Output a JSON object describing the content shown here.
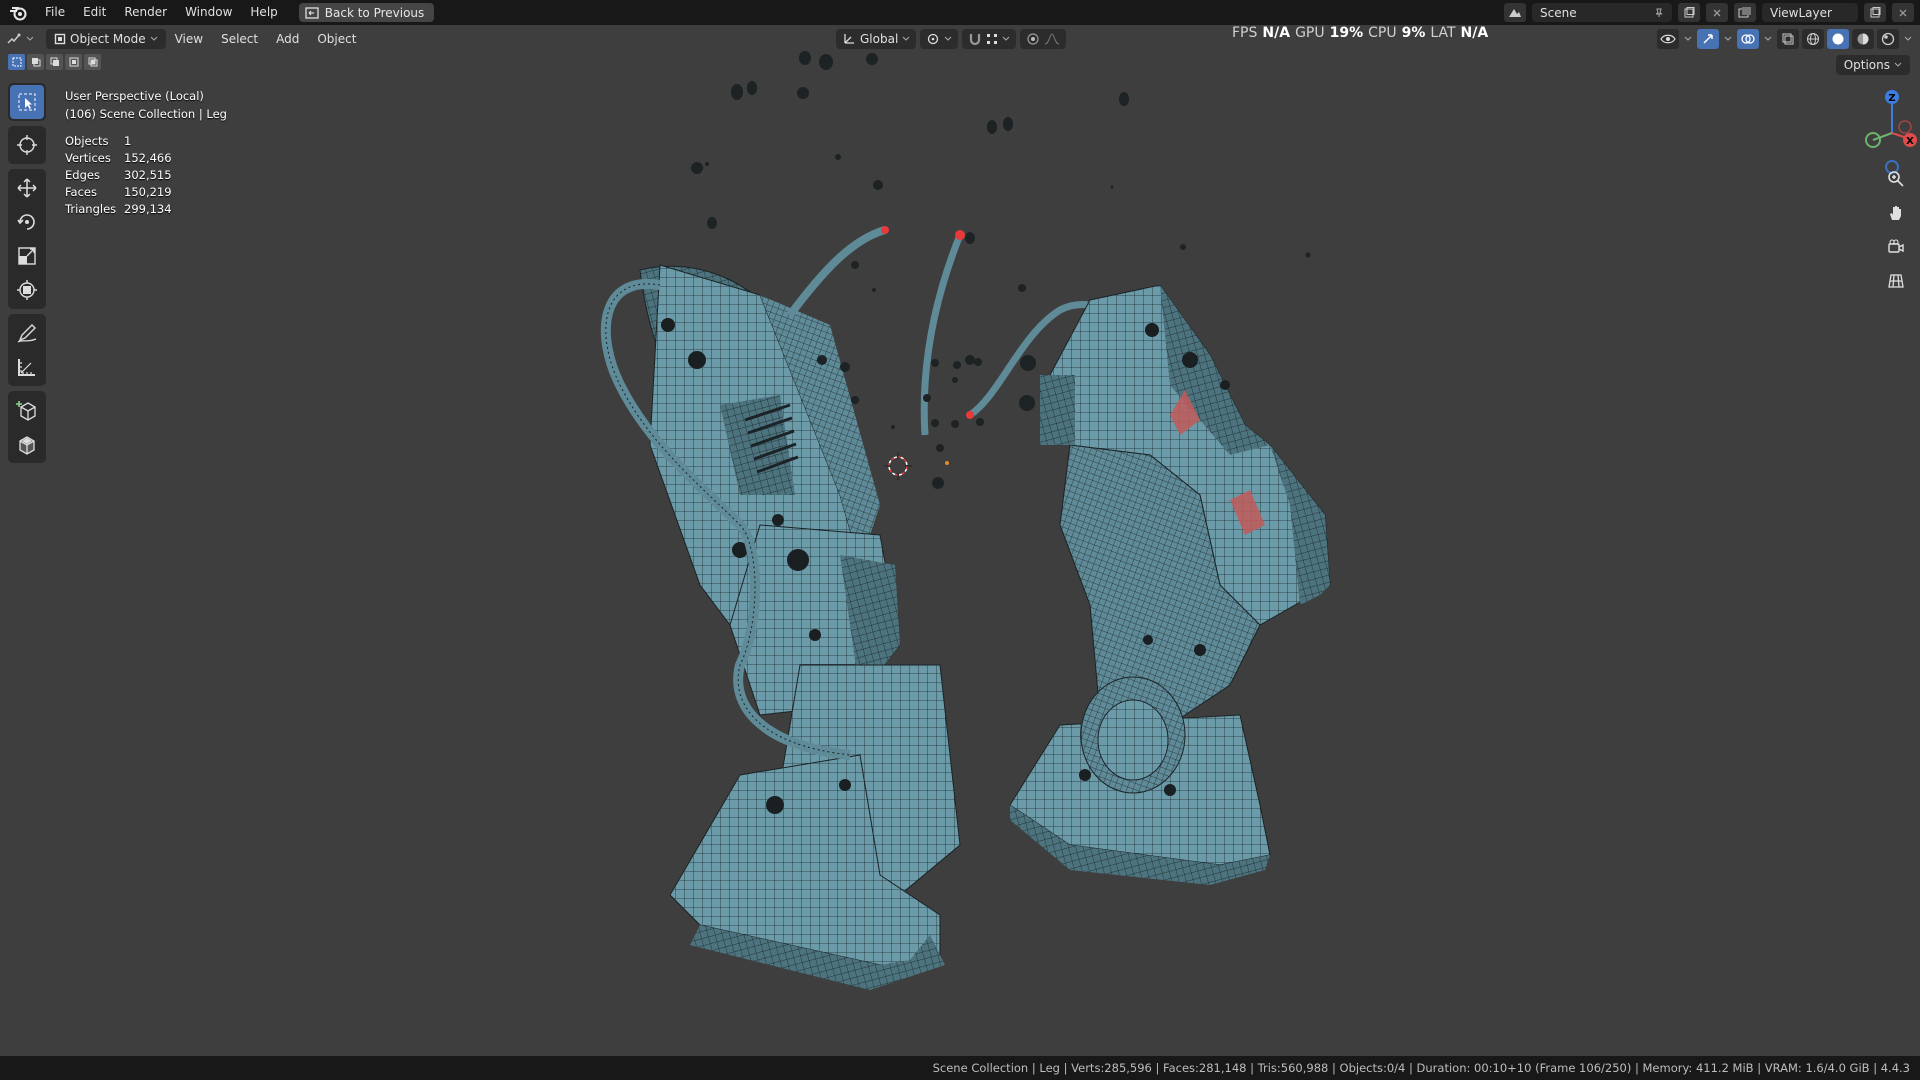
{
  "topbar": {
    "menus": [
      "File",
      "Edit",
      "Render",
      "Window",
      "Help"
    ],
    "back_label": "Back to Previous",
    "scene_name": "Scene",
    "view_layer": "ViewLayer"
  },
  "header": {
    "mode": "Object Mode",
    "menus": [
      "View",
      "Select",
      "Add",
      "Object"
    ],
    "orientation": "Global",
    "options_label": "Options"
  },
  "perf": {
    "fps_label": "FPS",
    "fps_value": "N/A",
    "gpu_label": "GPU",
    "gpu_value": "19%",
    "cpu_label": "CPU",
    "cpu_value": "9%",
    "lat_label": "LAT",
    "lat_value": "N/A"
  },
  "overlay": {
    "view_name": "User Perspective (Local)",
    "collection": "(106) Scene Collection | Leg",
    "stats": [
      {
        "label": "Objects",
        "value": "1"
      },
      {
        "label": "Vertices",
        "value": "152,466"
      },
      {
        "label": "Edges",
        "value": "302,515"
      },
      {
        "label": "Faces",
        "value": "150,219"
      },
      {
        "label": "Triangles",
        "value": "299,134"
      }
    ]
  },
  "gizmo": {
    "z": "Z",
    "x": "X"
  },
  "tools": [
    "select-box-tool",
    "cursor-tool",
    "move-tool",
    "rotate-tool",
    "scale-tool",
    "transform-tool",
    "annotate-tool",
    "measure-tool",
    "add-cube-tool",
    "extrude-tool"
  ],
  "statusbar": {
    "text": "Scene Collection | Leg | Verts:285,596 | Faces:281,148 | Tris:560,988 | Objects:0/4 | Duration: 00:10+10 (Frame 106/250) | Memory: 411.2 MiB | VRAM: 1.6/4.0 GiB | 4.4.3"
  },
  "colors": {
    "viewport_bg": "#3e3e3e",
    "mesh": "#6b9aa8",
    "wire": "#1e2a2f",
    "accent": "#4772b3",
    "selected": "#e83a3a"
  }
}
